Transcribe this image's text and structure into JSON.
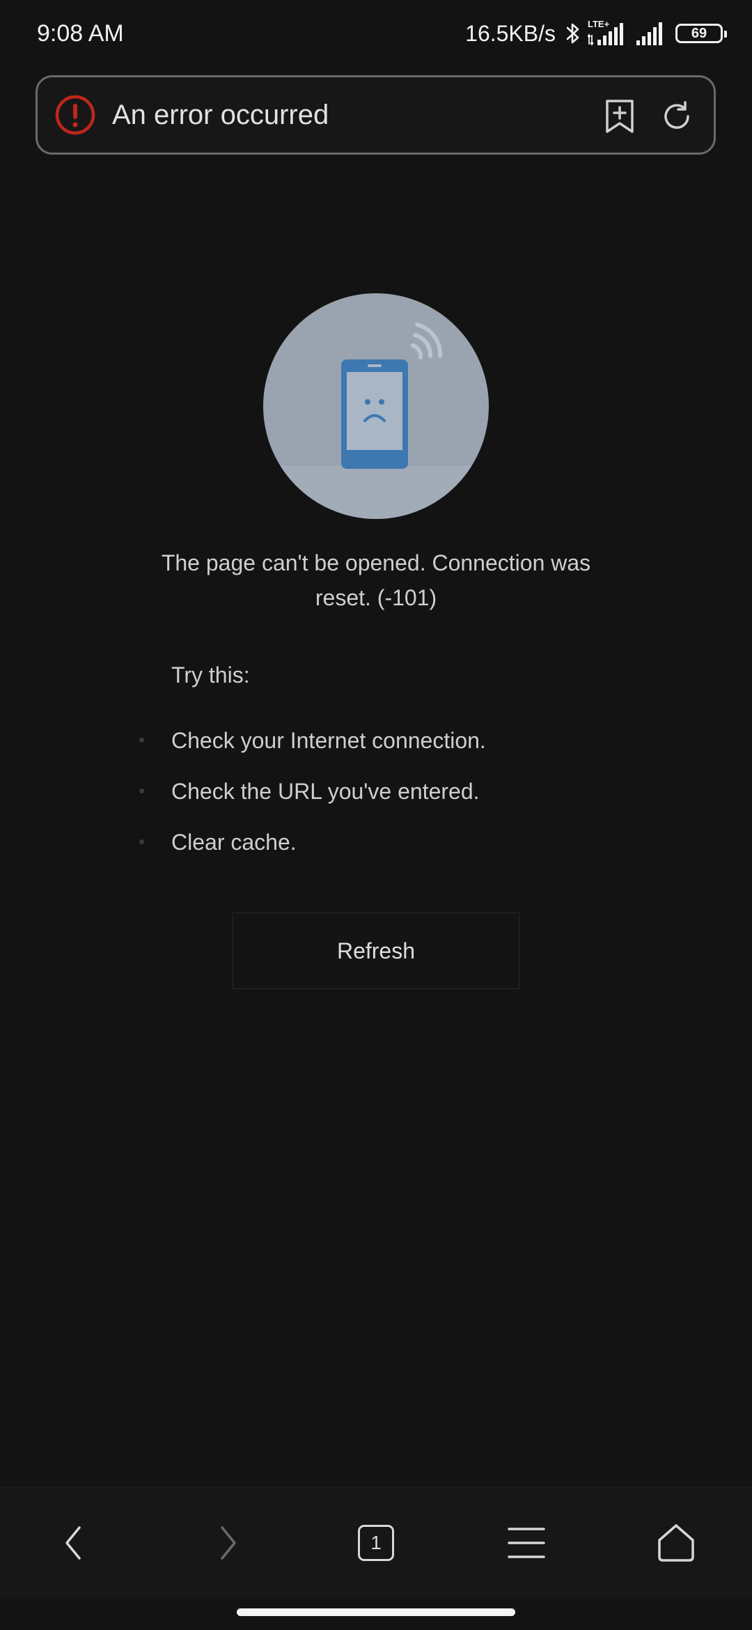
{
  "status_bar": {
    "time": "9:08 AM",
    "net_speed": "16.5KB/s",
    "network_label": "LTE+",
    "battery_level": "69",
    "icons": [
      "bluetooth-icon",
      "lte-signal-icon",
      "signal-icon",
      "battery-icon"
    ]
  },
  "address_bar": {
    "title": "An error occurred",
    "error_color": "#c0261b",
    "icons": [
      "error-icon",
      "bookmark-add-icon",
      "reload-icon"
    ]
  },
  "error_page": {
    "message": "The page can't be opened. Connection was reset. (-101)",
    "try_this": "Try this:",
    "tips": [
      {
        "text": "Check your Internet connection."
      },
      {
        "text": "Check the URL you've entered."
      },
      {
        "text": "Clear cache."
      }
    ],
    "refresh_label": "Refresh",
    "illustration_icon": "sad-phone-icon",
    "illustration_color": "#3d78b0"
  },
  "bottom_nav": {
    "tab_count": "1",
    "items": [
      "back-icon",
      "forward-icon",
      "tabs-icon",
      "menu-icon",
      "home-icon"
    ]
  }
}
